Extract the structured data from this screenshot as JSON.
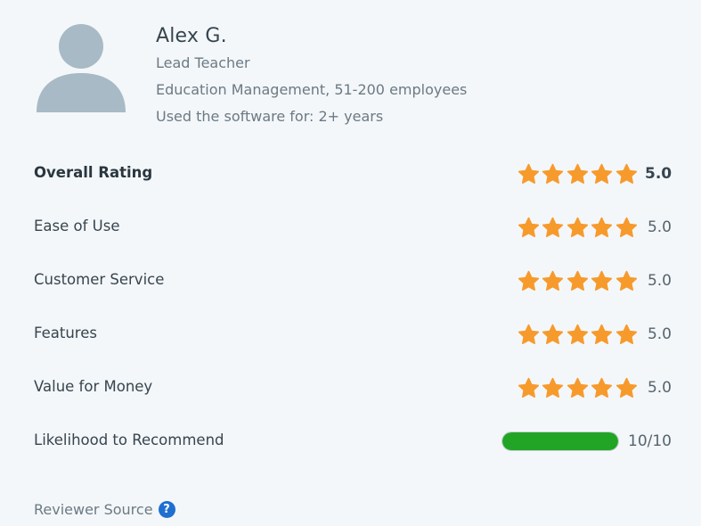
{
  "reviewer": {
    "name": "Alex G.",
    "role": "Lead Teacher",
    "company": "Education Management, 51-200 employees",
    "usage": "Used the software for: 2+ years",
    "avatar_icon": "person-silhouette-icon"
  },
  "ratings": {
    "overall": {
      "label": "Overall Rating",
      "value": "5.0",
      "stars": 5
    },
    "ease_of_use": {
      "label": "Ease of Use",
      "value": "5.0",
      "stars": 5
    },
    "customer_service": {
      "label": "Customer Service",
      "value": "5.0",
      "stars": 5
    },
    "features": {
      "label": "Features",
      "value": "5.0",
      "stars": 5
    },
    "value_for_money": {
      "label": "Value for Money",
      "value": "5.0",
      "stars": 5
    },
    "likelihood": {
      "label": "Likelihood to Recommend",
      "value": "10/10",
      "fraction": 1.0
    }
  },
  "source": {
    "label": "Reviewer Source",
    "icon": "question-mark-icon",
    "icon_glyph": "?"
  },
  "colors": {
    "star": "#f79a2c",
    "progress_fill": "#22a524",
    "help_icon": "#1f6fd1",
    "avatar": "#a7bac6",
    "background": "#f4f7f9"
  }
}
